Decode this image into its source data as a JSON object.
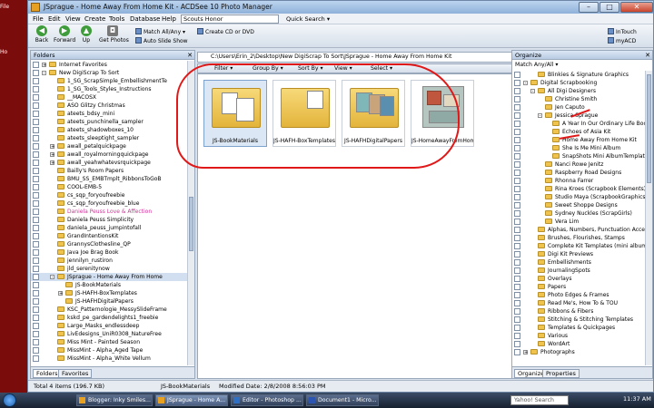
{
  "window": {
    "title": "JSprague - Home Away From Home Kit - ACDSee 10 Photo Manager",
    "min": "–",
    "max": "□",
    "close": "✕"
  },
  "desktop": {
    "labels": [
      "File",
      "Ho"
    ]
  },
  "menu": {
    "items": [
      "File",
      "Edit",
      "View",
      "Create",
      "Tools",
      "Database",
      "Help"
    ],
    "search_value": "Scouts Honor",
    "quick_search": "Quick Search ▾"
  },
  "toolbar": {
    "back": "Back",
    "forward": "Forward",
    "up": "Up",
    "get_photos": "Get Photos",
    "match": "Match All/Any ▾",
    "auto_slide": "Auto Slide Show",
    "create_cd": "Create CD or DVD",
    "intouch": "InTouch",
    "myacd": "myACD"
  },
  "folders": {
    "title": "Folders",
    "items": [
      {
        "label": "Internet Favorites",
        "indent": 0,
        "exp": "+"
      },
      {
        "label": "New DigiScrap To Sort",
        "indent": 0,
        "exp": "-"
      },
      {
        "label": "1_SG_ScrapSimple_EmbellishmentTe",
        "indent": 1
      },
      {
        "label": "1_SG_Tools_Styles_Instructions",
        "indent": 1
      },
      {
        "label": "__MACOSX",
        "indent": 1
      },
      {
        "label": "ASO Glitzy Christmas",
        "indent": 1
      },
      {
        "label": "ateets_bdsy_mini",
        "indent": 1
      },
      {
        "label": "ateets_punchinella_sampler",
        "indent": 1
      },
      {
        "label": "ateets_shadowboxes_10",
        "indent": 1
      },
      {
        "label": "ateets_sleeptight_sampler",
        "indent": 1
      },
      {
        "label": "awall_petalquickpage",
        "indent": 1,
        "exp": "+"
      },
      {
        "label": "awall_royalmorningquickpage",
        "indent": 1,
        "exp": "+"
      },
      {
        "label": "awall_yeahwhatevsrquickpage",
        "indent": 1,
        "exp": "+"
      },
      {
        "label": "Bailly's Room Papers",
        "indent": 1
      },
      {
        "label": "BMU_SS_EMBTmplt_RibbonsToGoB",
        "indent": 1
      },
      {
        "label": "COOL-EMB-5",
        "indent": 1
      },
      {
        "label": "cs_sqp_foryoufreebie",
        "indent": 1
      },
      {
        "label": "cs_sqp_foryoufreebie_blue",
        "indent": 1
      },
      {
        "label": "Daniela Peuss Love & Affection",
        "indent": 1,
        "pink": true
      },
      {
        "label": "Daniela Peuss Simplicity",
        "indent": 1
      },
      {
        "label": "daniela_peuss_jumpintofall",
        "indent": 1
      },
      {
        "label": "GrandIntentionsKit",
        "indent": 1
      },
      {
        "label": "GrannysClothesline_QP",
        "indent": 1
      },
      {
        "label": "Java Joe Brag Book",
        "indent": 1
      },
      {
        "label": "jennilyn_rustiron",
        "indent": 1
      },
      {
        "label": "jld_serenitynow",
        "indent": 1
      },
      {
        "label": "JSprague - Home Away From Home",
        "indent": 1,
        "exp": "-",
        "sel": true
      },
      {
        "label": "JS-BookMaterials",
        "indent": 2
      },
      {
        "label": "JS-HAFH-BoxTemplates",
        "indent": 2,
        "exp": "+"
      },
      {
        "label": "JS-HAFHDigitalPapers",
        "indent": 2
      },
      {
        "label": "KSC_Patternologie_MessySlideFrame",
        "indent": 1
      },
      {
        "label": "kskd_pe_gardendelights1_freebie",
        "indent": 1
      },
      {
        "label": "Large_Masks_endlessdeep",
        "indent": 1
      },
      {
        "label": "LivEdesigns_UniR0308_NatureFree",
        "indent": 1
      },
      {
        "label": "Miss Mint - Painted Season",
        "indent": 1
      },
      {
        "label": "MissMint - Alpha_Aged Tape",
        "indent": 1
      },
      {
        "label": "MissMint - Alpha_White Vellum",
        "indent": 1
      }
    ],
    "tabs": [
      "Folders",
      "Favorites"
    ]
  },
  "browser": {
    "path": "C:\\Users\\Erin_2\\Desktop\\New DigiScrap To Sort\\JSprague - Home Away From Home Kit",
    "filter": "Filter ▾",
    "group": "Group By ▾",
    "sort": "Sort By ▾",
    "view": "View ▾",
    "select": "Select ▾",
    "tiles": [
      {
        "label": "JS-BookMaterials",
        "kind": "folder-photos"
      },
      {
        "label": "JS-HAFH-BoxTemplates",
        "kind": "folder-white"
      },
      {
        "label": "JS-HAFHDigitalPapers",
        "kind": "folder-papers"
      },
      {
        "label": "JS-HomeAwayFromHom...",
        "kind": "image"
      }
    ]
  },
  "organize": {
    "title": "Organize",
    "match": "Match Any/All ▾",
    "items": [
      {
        "label": "Blinkies & Signature Graphics",
        "indent": 1
      },
      {
        "label": "Digital Scrapbooking",
        "indent": 0,
        "exp": "-"
      },
      {
        "label": "All Digi Designers",
        "indent": 1,
        "exp": "-"
      },
      {
        "label": "Christine Smith",
        "indent": 2
      },
      {
        "label": "Jen Caputo",
        "indent": 2
      },
      {
        "label": "Jessica Sprague",
        "indent": 2,
        "exp": "-"
      },
      {
        "label": "A Year In Our Ordinary Life Book",
        "indent": 3
      },
      {
        "label": "Echoes of Asia Kit",
        "indent": 3
      },
      {
        "label": "Home Away From Home Kit",
        "indent": 3
      },
      {
        "label": "She Is Me Mini Album",
        "indent": 3
      },
      {
        "label": "SnapShots Mini AlbumTemplate",
        "indent": 3
      },
      {
        "label": "Nanci Rowe Jenitz",
        "indent": 2
      },
      {
        "label": "Raspberry Road Designs",
        "indent": 2
      },
      {
        "label": "Rhonna Farrer",
        "indent": 2
      },
      {
        "label": "Rina Kroes (Scrapbook Elements)",
        "indent": 2
      },
      {
        "label": "Studio Maya (ScrapbookGraphics)",
        "indent": 2
      },
      {
        "label": "Sweet Shoppe Designs",
        "indent": 2
      },
      {
        "label": "Sydney Nuckles (ScrapGirls)",
        "indent": 2
      },
      {
        "label": "Vera Lim",
        "indent": 2
      },
      {
        "label": "Alphas, Numbers, Punctuation Accents",
        "indent": 1
      },
      {
        "label": "Brushes, Flourishes, Stamps",
        "indent": 1
      },
      {
        "label": "Complete Kit Templates (mini albums, e",
        "indent": 1
      },
      {
        "label": "Digi Kit Previews",
        "indent": 1
      },
      {
        "label": "Embellishments",
        "indent": 1
      },
      {
        "label": "JournalingSpots",
        "indent": 1
      },
      {
        "label": "Overlays",
        "indent": 1
      },
      {
        "label": "Papers",
        "indent": 1
      },
      {
        "label": "Photo Edges & Frames",
        "indent": 1
      },
      {
        "label": "Read Me's, How To & TOU",
        "indent": 1
      },
      {
        "label": "Ribbons & Fibers",
        "indent": 1
      },
      {
        "label": "Stitching & Stitching Templates",
        "indent": 1
      },
      {
        "label": "Templates & Quickpages",
        "indent": 1
      },
      {
        "label": "Various",
        "indent": 1
      },
      {
        "label": "WordArt",
        "indent": 1
      },
      {
        "label": "Photographs",
        "indent": 0,
        "exp": "+"
      }
    ],
    "tabs": [
      "Organize",
      "Properties"
    ]
  },
  "status": {
    "total": "Total 4 items  (196.7 KB)",
    "selected": "JS-BookMaterials",
    "modified": "Modified Date: 2/8/2008 8:56:03 PM"
  },
  "taskbar": {
    "tasks": [
      "Blogger: Inky Smiles...",
      "JSprague - Home A...",
      "Editor - Photoshop ...",
      "Document1 - Micro..."
    ],
    "search_placeholder": "Yahoo! Search",
    "clock": "11:37 AM"
  }
}
